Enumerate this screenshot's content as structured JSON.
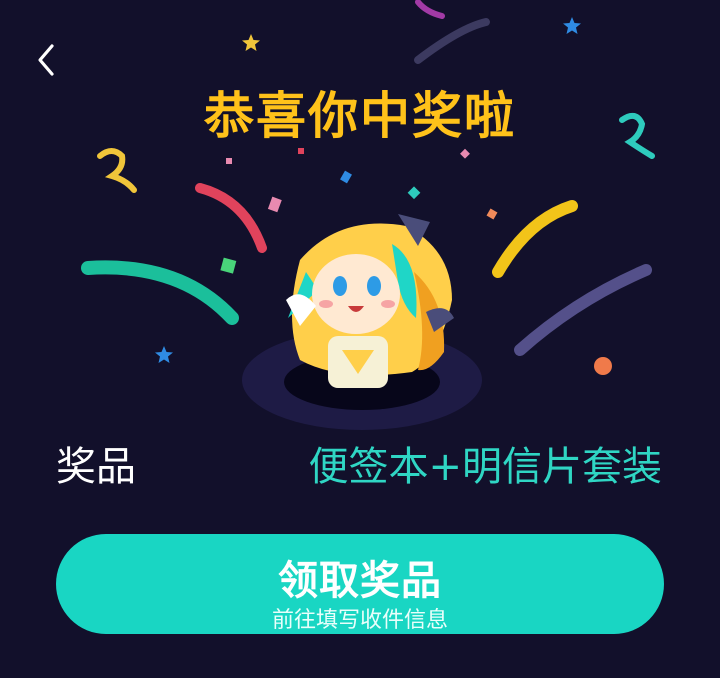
{
  "nav": {
    "back_icon": "chevron-left-icon"
  },
  "header": {
    "title": "恭喜你中奖啦"
  },
  "prize": {
    "label": "奖品",
    "value": "便签本+明信片套装"
  },
  "cta": {
    "label": "领取奖品",
    "sublabel": "前往填写收件信息"
  },
  "colors": {
    "background": "#12102b",
    "title": "#ffc21a",
    "accent_teal": "#19d6c3",
    "prize_value": "#2fd6c4"
  }
}
